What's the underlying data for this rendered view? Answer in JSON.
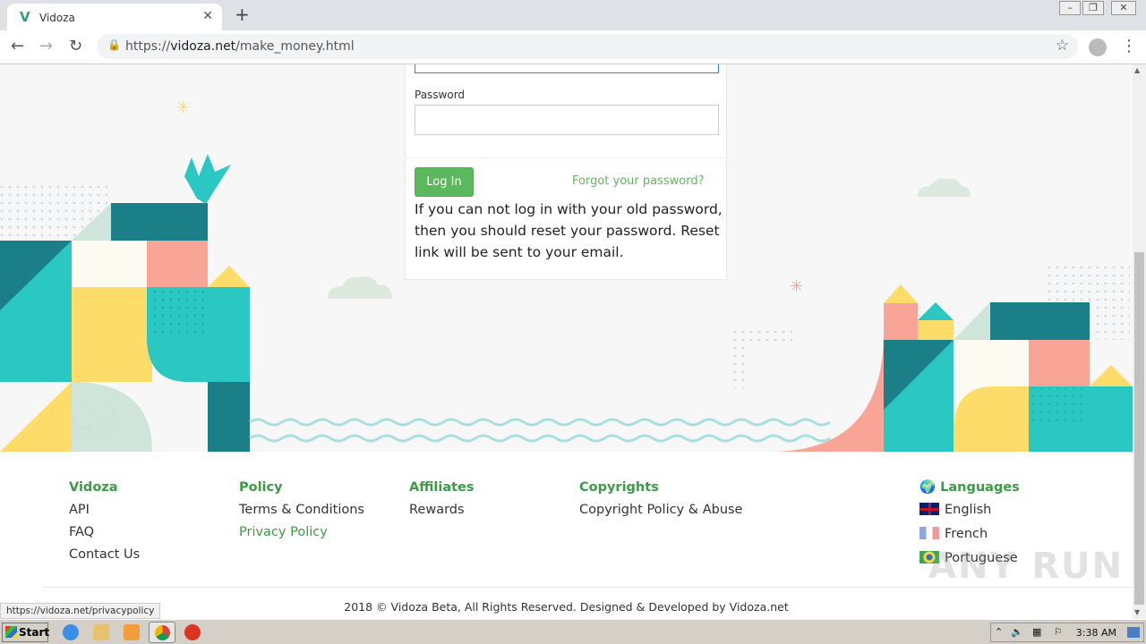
{
  "browser": {
    "tab_title": "Vidoza",
    "tab_favicon": "V",
    "url_host": "vidoza.net",
    "url_prefix": "https://",
    "url_path": "/make_money.html"
  },
  "login": {
    "password_label": "Password",
    "login_button": "Log In",
    "forgot_link": "Forgot your password?",
    "note": "If you can not log in with your old password, then you should reset your password. Reset link will be sent to your email."
  },
  "footer": {
    "col1": {
      "heading": "Vidoza",
      "links": [
        "API",
        "FAQ",
        "Contact Us"
      ]
    },
    "col2": {
      "heading": "Policy",
      "links": [
        "Terms & Conditions",
        "Privacy Policy"
      ]
    },
    "col3": {
      "heading": "Affiliates",
      "links": [
        "Rewards"
      ]
    },
    "col4": {
      "heading": "Copyrights",
      "links": [
        "Copyright Policy & Abuse"
      ]
    },
    "languages": {
      "heading": "Languages",
      "items": [
        "English",
        "French",
        "Portuguese"
      ]
    },
    "copyright": "2018 © Vidoza Beta, All Rights Reserved. Designed & Developed by Vidoza.net"
  },
  "status_url": "https://vidoza.net/privacypolicy",
  "watermark": "ANY RUN",
  "taskbar": {
    "start_label": "Start",
    "clock": "3:38 AM"
  },
  "colors": {
    "accent_green": "#5cb85c",
    "heading_green": "#3c9b45",
    "teal": "#2bc7c2",
    "dark_teal": "#1a7f86",
    "yellow": "#fddc6a",
    "salmon": "#f8a597"
  }
}
